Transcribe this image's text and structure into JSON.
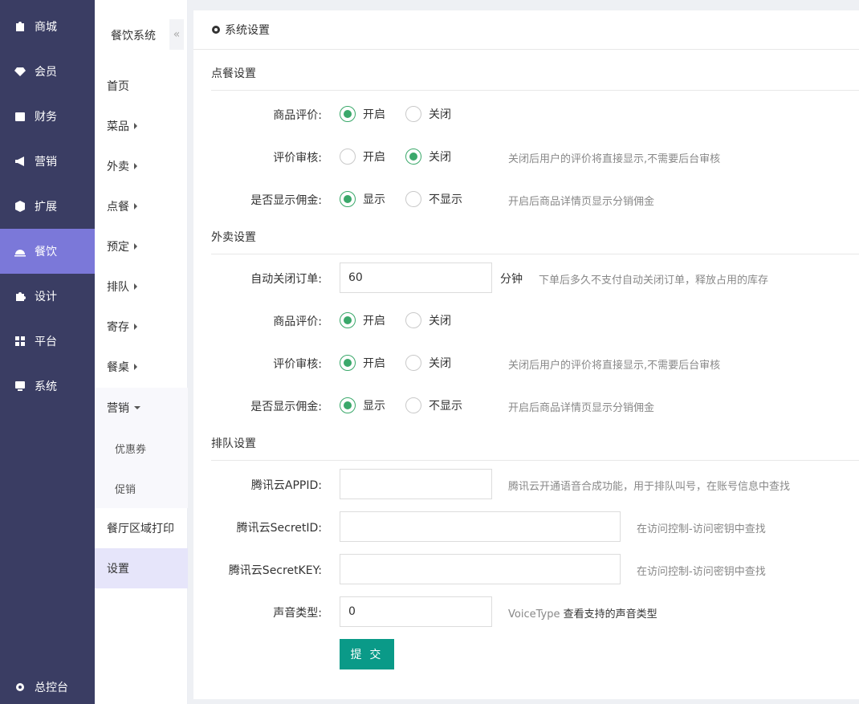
{
  "sidebar1": {
    "items": [
      {
        "label": "商城",
        "icon": "shop-bag-icon"
      },
      {
        "label": "会员",
        "icon": "gem-icon"
      },
      {
        "label": "财务",
        "icon": "wallet-icon"
      },
      {
        "label": "营销",
        "icon": "megaphone-icon"
      },
      {
        "label": "扩展",
        "icon": "cube-icon"
      },
      {
        "label": "餐饮",
        "icon": "cloche-icon"
      },
      {
        "label": "设计",
        "icon": "puzzle-icon"
      },
      {
        "label": "平台",
        "icon": "grid-icon"
      },
      {
        "label": "系统",
        "icon": "monitor-icon"
      }
    ],
    "active": "餐饮",
    "bottom": {
      "label": "总控台",
      "icon": "gear-icon"
    }
  },
  "sidebar2": {
    "title": "餐饮系统",
    "collapse_glyph": "«",
    "items": [
      "首页",
      "菜品",
      "外卖",
      "点餐",
      "预定",
      "排队",
      "寄存",
      "餐桌",
      "营销"
    ],
    "sub_items": [
      "优惠券",
      "促销"
    ],
    "print": "餐厅区域打印",
    "settings": "设置"
  },
  "header": {
    "title": "系统设置",
    "icon": "gear-icon"
  },
  "dine": {
    "title": "点餐设置",
    "review_label": "商品评价:",
    "audit_label": "评价审核:",
    "commission_label": "是否显示佣金:",
    "on": "开启",
    "off": "关闭",
    "show": "显示",
    "hide": "不显示",
    "audit_hint": "关闭后用户的评价将直接显示,不需要后台审核",
    "commission_hint": "开启后商品详情页显示分销佣金"
  },
  "takeout": {
    "title": "外卖设置",
    "autoclose_label": "自动关闭订单:",
    "autoclose_value": "60",
    "autoclose_unit": "分钟",
    "autoclose_hint": "下单后多久不支付自动关闭订单，释放占用的库存",
    "review_label": "商品评价:",
    "audit_label": "评价审核:",
    "commission_label": "是否显示佣金:",
    "on": "开启",
    "off": "关闭",
    "show": "显示",
    "hide": "不显示",
    "audit_hint": "关闭后用户的评价将直接显示,不需要后台审核",
    "commission_hint": "开启后商品详情页显示分销佣金"
  },
  "queue": {
    "title": "排队设置",
    "appid_label": "腾讯云APPID:",
    "appid_value": "",
    "appid_hint": "腾讯云开通语音合成功能，用于排队叫号，在账号信息中查找",
    "secretid_label": "腾讯云SecretID:",
    "secretid_value": "",
    "secretid_hint": "在访问控制-访问密钥中查找",
    "secretkey_label": "腾讯云SecretKEY:",
    "secretkey_value": "",
    "secretkey_hint": "在访问控制-访问密钥中查找",
    "voice_label": "声音类型:",
    "voice_value": "0",
    "voice_hint_prefix": "VoiceType",
    "voice_hint_link": "查看支持的声音类型"
  },
  "submit_label": "提 交"
}
